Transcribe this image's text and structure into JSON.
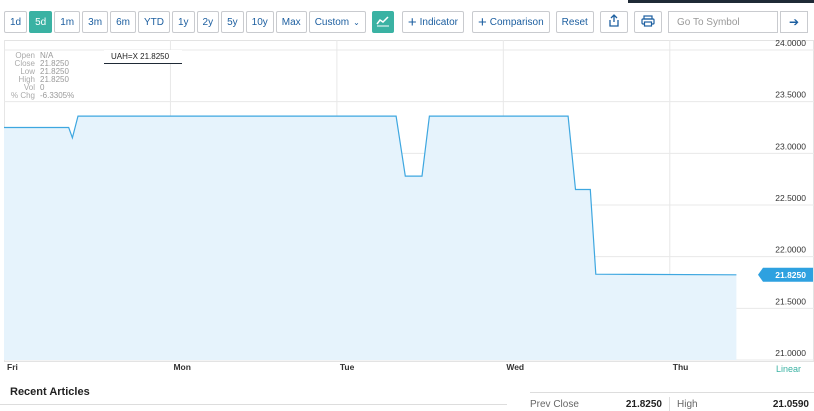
{
  "toolbar": {
    "ranges": [
      "1d",
      "5d",
      "1m",
      "3m",
      "6m",
      "YTD",
      "1y",
      "2y",
      "5y",
      "10y",
      "Max"
    ],
    "active_range": "5d",
    "custom_label": "Custom",
    "indicator_label": "Indicator",
    "comparison_label": "Comparison",
    "reset_label": "Reset",
    "symbol_placeholder": "Go To Symbol"
  },
  "info_panel": {
    "rows": [
      {
        "label": "Open",
        "value": "N/A"
      },
      {
        "label": "Close",
        "value": "21.8250"
      },
      {
        "label": "Low",
        "value": "21.8250"
      },
      {
        "label": "High",
        "value": "21.8250"
      },
      {
        "label": "Vol",
        "value": "0"
      },
      {
        "label": "% Chg",
        "value": "-6.3305%"
      }
    ]
  },
  "legend": "UAH=X 21.8250",
  "scale_label": "Linear",
  "current_price_label": "21.8250",
  "colors": {
    "accent": "#3ab2a3",
    "line": "#3ea7e0",
    "fill": "#e6f3fc",
    "price_tag": "#2ea1e0"
  },
  "chart_data": {
    "type": "area",
    "series": [
      {
        "name": "UAH=X",
        "x": [
          0,
          0.35,
          0.37,
          0.4,
          2.12,
          2.17,
          2.26,
          2.3,
          3.05,
          3.09,
          3.17,
          3.2,
          3.96
        ],
        "values": [
          23.25,
          23.25,
          23.15,
          23.36,
          23.36,
          22.78,
          22.78,
          23.36,
          23.36,
          22.65,
          22.65,
          21.83,
          21.825
        ]
      }
    ],
    "x_ticks": [
      {
        "label": "Fri",
        "x": 0
      },
      {
        "label": "Mon",
        "x": 0.9
      },
      {
        "label": "Tue",
        "x": 1.8
      },
      {
        "label": "Wed",
        "x": 2.7
      },
      {
        "label": "Thu",
        "x": 3.6
      }
    ],
    "y_ticks": [
      "24.0000",
      "23.5000",
      "23.0000",
      "22.5000",
      "22.0000",
      "21.5000",
      "21.0000"
    ],
    "ylim": [
      21.0,
      24.0
    ],
    "xlim": [
      0,
      4.05
    ],
    "grid": true
  },
  "stats": {
    "prev_close_label": "Prev Close",
    "prev_close_value": "21.8250",
    "high_label": "High",
    "high_value": "21.0590"
  },
  "recent_articles_label": "Recent Articles"
}
